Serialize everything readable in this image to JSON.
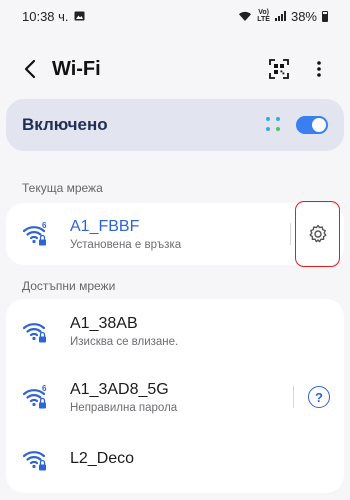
{
  "status_bar": {
    "time": "10:38 ч.",
    "volte_top": "Vo)",
    "volte_bottom": "LTE",
    "battery": "38%"
  },
  "app_bar": {
    "title": "Wi-Fi",
    "back_icon": "chevron-left-icon",
    "qr_icon": "qr-scan-icon",
    "more_icon": "more-vertical-icon"
  },
  "master_switch": {
    "label": "Включено",
    "enabled": true,
    "accent": "#3a7ff0"
  },
  "current_network": {
    "section_label": "Текуща мрежа",
    "name": "A1_FBBF",
    "status": "Установена е връзка",
    "wifi6": true,
    "secured": true,
    "action_icon": "gear-icon"
  },
  "available_networks": {
    "section_label": "Достъпни мрежи",
    "items": [
      {
        "name": "A1_38AB",
        "status": "Изисква се влизане.",
        "wifi6": false,
        "secured": true
      },
      {
        "name": "A1_3AD8_5G",
        "status": "Неправилна парола",
        "wifi6": true,
        "secured": true,
        "action_icon": "help-icon",
        "action_label": "?"
      },
      {
        "name": "L2_Deco",
        "status": "",
        "wifi6": false,
        "secured": true
      }
    ]
  }
}
